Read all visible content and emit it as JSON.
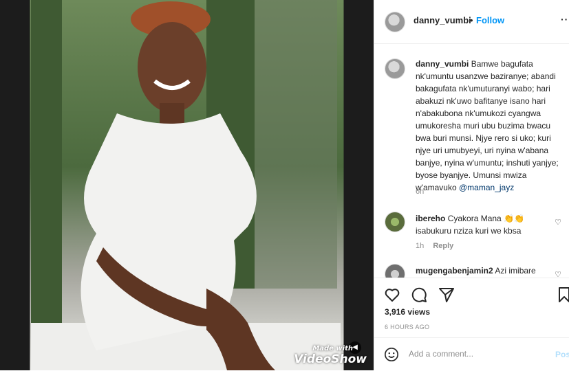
{
  "post": {
    "username": "danny_vumbi",
    "follow_label": "Follow",
    "separator": "•",
    "more_label": "···"
  },
  "media": {
    "watermark": "VideoShow",
    "watermark_prefix": "Made with",
    "description": "Smiling woman in white ruffled dress"
  },
  "caption": {
    "username": "danny_vumbi",
    "text": "Bamwe bagufata nk'umuntu usanzwe baziranye; abandi bakagufata nk'umuturanyi wabo; hari abakuzi nk'uwo bafitanye isano hari n'abakubona nk'umukozi cyangwa umukoresha muri ubu buzima bwacu bwa buri munsi. Njye rero si uko; kuri njye uri umubyeyi, uri nyina w'abana banjye, nyina w'umuntu; inshuti yanjye; byose byanjye. Umunsi mwiza w'amavuko ",
    "mention": "@maman_jayz",
    "time": "6h"
  },
  "comments": [
    {
      "username": "ibereho",
      "text": "Cyakora Mana 👏👏 isabukuru nziza kuri we kbsa",
      "time": "1h",
      "reply_label": "Reply"
    },
    {
      "username": "mugengabenjamin2",
      "text": "Azi imibare",
      "time": "",
      "reply_label": ""
    }
  ],
  "actions": {
    "views": "3,916 views",
    "posted": "6 HOURS AGO",
    "icons": [
      "heart-icon",
      "comment-icon",
      "share-icon",
      "bookmark-icon"
    ]
  },
  "add_comment": {
    "placeholder": "Add a comment...",
    "post_label": "Post"
  },
  "colors": {
    "link": "#0095f6",
    "mention": "#00376b",
    "muted": "#8e8e8e",
    "border": "#efefef"
  }
}
